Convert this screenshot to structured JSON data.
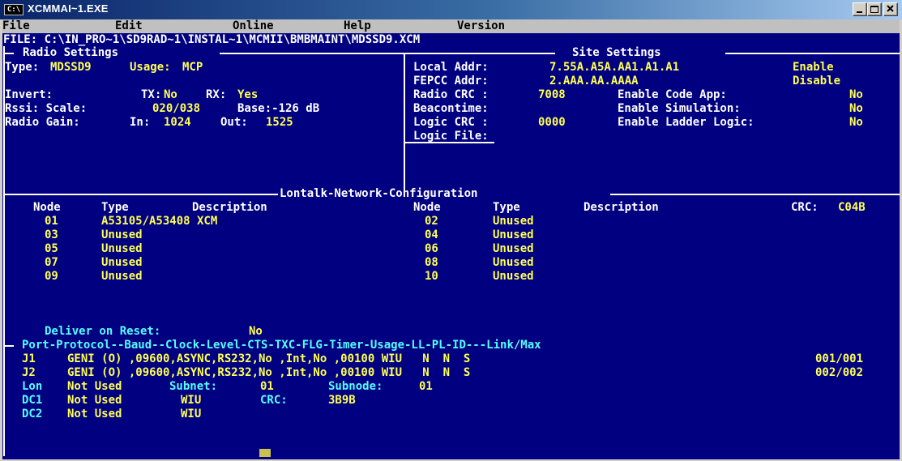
{
  "window": {
    "title": "XCMMAI~1.EXE",
    "icon_label": "C:\\"
  },
  "menu": {
    "file": "File",
    "edit": "Edit",
    "online": "Online",
    "help": "Help",
    "version": "Version"
  },
  "file_path": "FILE: C:\\IN_PRO~1\\SD9RAD~1\\INSTAL~1\\MCMII\\BMBMAINT\\MDSSD9.XCM",
  "radio": {
    "header": "Radio Settings",
    "type_label": "Type:",
    "type_value": "MDSSD9",
    "usage_label": "Usage:",
    "usage_value": "MCP",
    "invert_label": "Invert:",
    "tx_label": "TX:",
    "tx_value": "No",
    "rx_label": "RX:",
    "rx_value": "Yes",
    "rssi_label": "Rssi: Scale:",
    "rssi_scale": "020/038",
    "rssi_base": "Base:-126 dB",
    "gain_label": "Radio Gain:",
    "gain_in_label": "In:",
    "gain_in": "1024",
    "gain_out_label": "Out:",
    "gain_out": "1525"
  },
  "site": {
    "header": "Site Settings",
    "local_addr_label": "Local Addr:",
    "local_addr": "7.55A.A5A.AA1.A1.A1",
    "local_status": "Enable",
    "fepcc_label": "FEPCC Addr:",
    "fepcc_addr": "2.AAA.AA.AAAA",
    "fepcc_status": "Disable",
    "radio_crc_label": "Radio CRC :",
    "radio_crc": "7008",
    "code_app_label": "Enable Code App:",
    "code_app": "No",
    "beacon_label": "Beacontime:",
    "simulation_label": "Enable Simulation:",
    "simulation": "No",
    "logic_crc_label": "Logic CRC :",
    "logic_crc": "0000",
    "ladder_label": "Enable Ladder Logic:",
    "ladder": "No",
    "logic_file_label": "Logic File:"
  },
  "lontalk": {
    "header": "Lontalk-Network-Configuration",
    "col_node": "Node",
    "col_type": "Type",
    "col_desc": "Description",
    "crc_label": "CRC:",
    "crc_value": "C04B",
    "left_nodes": [
      {
        "node": "01",
        "type": "A53105/A53408 XCM"
      },
      {
        "node": "03",
        "type": "Unused"
      },
      {
        "node": "05",
        "type": "Unused"
      },
      {
        "node": "07",
        "type": "Unused"
      },
      {
        "node": "09",
        "type": "Unused"
      }
    ],
    "right_nodes": [
      {
        "node": "02",
        "type": "Unused"
      },
      {
        "node": "04",
        "type": "Unused"
      },
      {
        "node": "06",
        "type": "Unused"
      },
      {
        "node": "08",
        "type": "Unused"
      },
      {
        "node": "10",
        "type": "Unused"
      }
    ]
  },
  "deliver": {
    "label": "Deliver on Reset:",
    "value": "No"
  },
  "ports": {
    "header": "Port-Protocol--Baud--Clock-Level-CTS-TXC-FLG-Timer-Usage-LL-PL-ID---Link/Max",
    "rows": [
      {
        "port": "J1",
        "data": "GENI (O) ,09600,ASYNC,RS232,No ,Int,No ,00100 WIU   N  N  S",
        "link": "001/001"
      },
      {
        "port": "J2",
        "data": "GENI (O) ,09600,ASYNC,RS232,No ,Int,No ,00100 WIU   N  N  S",
        "link": "002/002"
      }
    ],
    "lon_port": "Lon",
    "lon_protocol": "Not Used",
    "subnet_label": "Subnet:",
    "subnet": "01",
    "subnode_label": "Subnode:",
    "subnode": "01",
    "dc1_port": "DC1",
    "dc1_protocol": "Not Used",
    "dc1_usage": "WIU",
    "dc1_crc_label": "CRC:",
    "dc1_crc": "3B9B",
    "dc2_port": "DC2",
    "dc2_protocol": "Not Used",
    "dc2_usage": "WIU"
  }
}
